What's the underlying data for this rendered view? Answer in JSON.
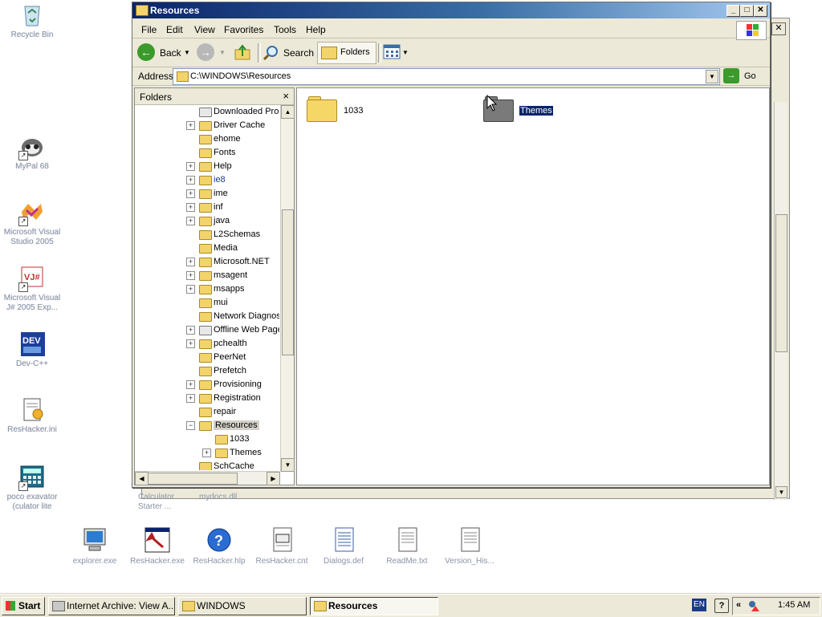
{
  "desktop_icons": [
    {
      "label": "Recycle Bin",
      "icon": "recycle-bin-icon"
    },
    {
      "label": "MyPal 68",
      "icon": "raccoon-icon"
    },
    {
      "label": "Microsoft Visual Studio 2005",
      "icon": "visual-studio-icon"
    },
    {
      "label": "Microsoft Visual J# 2005 Exp...",
      "icon": "vjsharp-icon"
    },
    {
      "label": "Dev-C++",
      "icon": "devcpp-icon"
    },
    {
      "label": "ResHacker.ini",
      "icon": "ini-file-icon"
    },
    {
      "label": "poco exavator (culator lite",
      "icon": "calculator-icon"
    }
  ],
  "ghost_labels": [
    "Calculator Starter ...",
    "mydocs.dll"
  ],
  "bottom_icons": [
    {
      "label": "explorer.exe",
      "icon": "computer-icon"
    },
    {
      "label": "ResHacker.exe",
      "icon": "reshacker-icon"
    },
    {
      "label": "ResHacker.hlp",
      "icon": "help-file-icon"
    },
    {
      "label": "ResHacker.cnt",
      "icon": "cnt-file-icon"
    },
    {
      "label": "Dialogs.def",
      "icon": "text-file-icon"
    },
    {
      "label": "ReadMe.txt",
      "icon": "text-file-icon"
    },
    {
      "label": "Version_His...",
      "icon": "text-file-icon"
    }
  ],
  "window": {
    "title": "Resources",
    "menu": [
      "File",
      "Edit",
      "View",
      "Favorites",
      "Tools",
      "Help"
    ],
    "toolbar": {
      "back": "Back",
      "search": "Search",
      "folders": "Folders"
    },
    "address": {
      "label": "Address",
      "value": "C:\\WINDOWS\\Resources",
      "go": "Go"
    },
    "folders_pane": {
      "title": "Folders",
      "close": "×"
    }
  },
  "tree": [
    {
      "name": "Downloaded Prog",
      "exp": "",
      "level": 1,
      "selected": false,
      "special": true
    },
    {
      "name": "Driver Cache",
      "exp": "+",
      "level": 1,
      "selected": false
    },
    {
      "name": "ehome",
      "exp": "",
      "level": 1,
      "selected": false
    },
    {
      "name": "Fonts",
      "exp": "",
      "level": 1,
      "selected": false
    },
    {
      "name": "Help",
      "exp": "+",
      "level": 1,
      "selected": false
    },
    {
      "name": "ie8",
      "exp": "+",
      "level": 1,
      "selected": false,
      "link": true
    },
    {
      "name": "ime",
      "exp": "+",
      "level": 1,
      "selected": false
    },
    {
      "name": "inf",
      "exp": "+",
      "level": 1,
      "selected": false
    },
    {
      "name": "java",
      "exp": "+",
      "level": 1,
      "selected": false
    },
    {
      "name": "L2Schemas",
      "exp": "",
      "level": 1,
      "selected": false
    },
    {
      "name": "Media",
      "exp": "",
      "level": 1,
      "selected": false
    },
    {
      "name": "Microsoft.NET",
      "exp": "+",
      "level": 1,
      "selected": false
    },
    {
      "name": "msagent",
      "exp": "+",
      "level": 1,
      "selected": false
    },
    {
      "name": "msapps",
      "exp": "+",
      "level": 1,
      "selected": false
    },
    {
      "name": "mui",
      "exp": "",
      "level": 1,
      "selected": false
    },
    {
      "name": "Network Diagnos",
      "exp": "",
      "level": 1,
      "selected": false
    },
    {
      "name": "Offline Web Page",
      "exp": "+",
      "level": 1,
      "selected": false,
      "special": true
    },
    {
      "name": "pchealth",
      "exp": "+",
      "level": 1,
      "selected": false
    },
    {
      "name": "PeerNet",
      "exp": "",
      "level": 1,
      "selected": false
    },
    {
      "name": "Prefetch",
      "exp": "",
      "level": 1,
      "selected": false
    },
    {
      "name": "Provisioning",
      "exp": "+",
      "level": 1,
      "selected": false
    },
    {
      "name": "Registration",
      "exp": "+",
      "level": 1,
      "selected": false
    },
    {
      "name": "repair",
      "exp": "",
      "level": 1,
      "selected": false
    },
    {
      "name": "Resources",
      "exp": "−",
      "level": 1,
      "selected": true
    },
    {
      "name": "1033",
      "exp": "",
      "level": 2,
      "selected": false
    },
    {
      "name": "Themes",
      "exp": "+",
      "level": 2,
      "selected": false
    },
    {
      "name": "SchCache",
      "exp": "",
      "level": 1,
      "selected": false
    }
  ],
  "content_items": [
    {
      "name": "1033",
      "selected": false,
      "color": "#f5d768"
    },
    {
      "name": "Themes",
      "selected": true,
      "color": "#7a7a7a"
    }
  ],
  "taskbar": {
    "start": "Start",
    "buttons": [
      {
        "label": "Internet Archive: View A...",
        "active": false
      },
      {
        "label": "WINDOWS",
        "active": false
      },
      {
        "label": "Resources",
        "active": true
      }
    ],
    "lang": "EN",
    "time": "1:45 AM"
  }
}
